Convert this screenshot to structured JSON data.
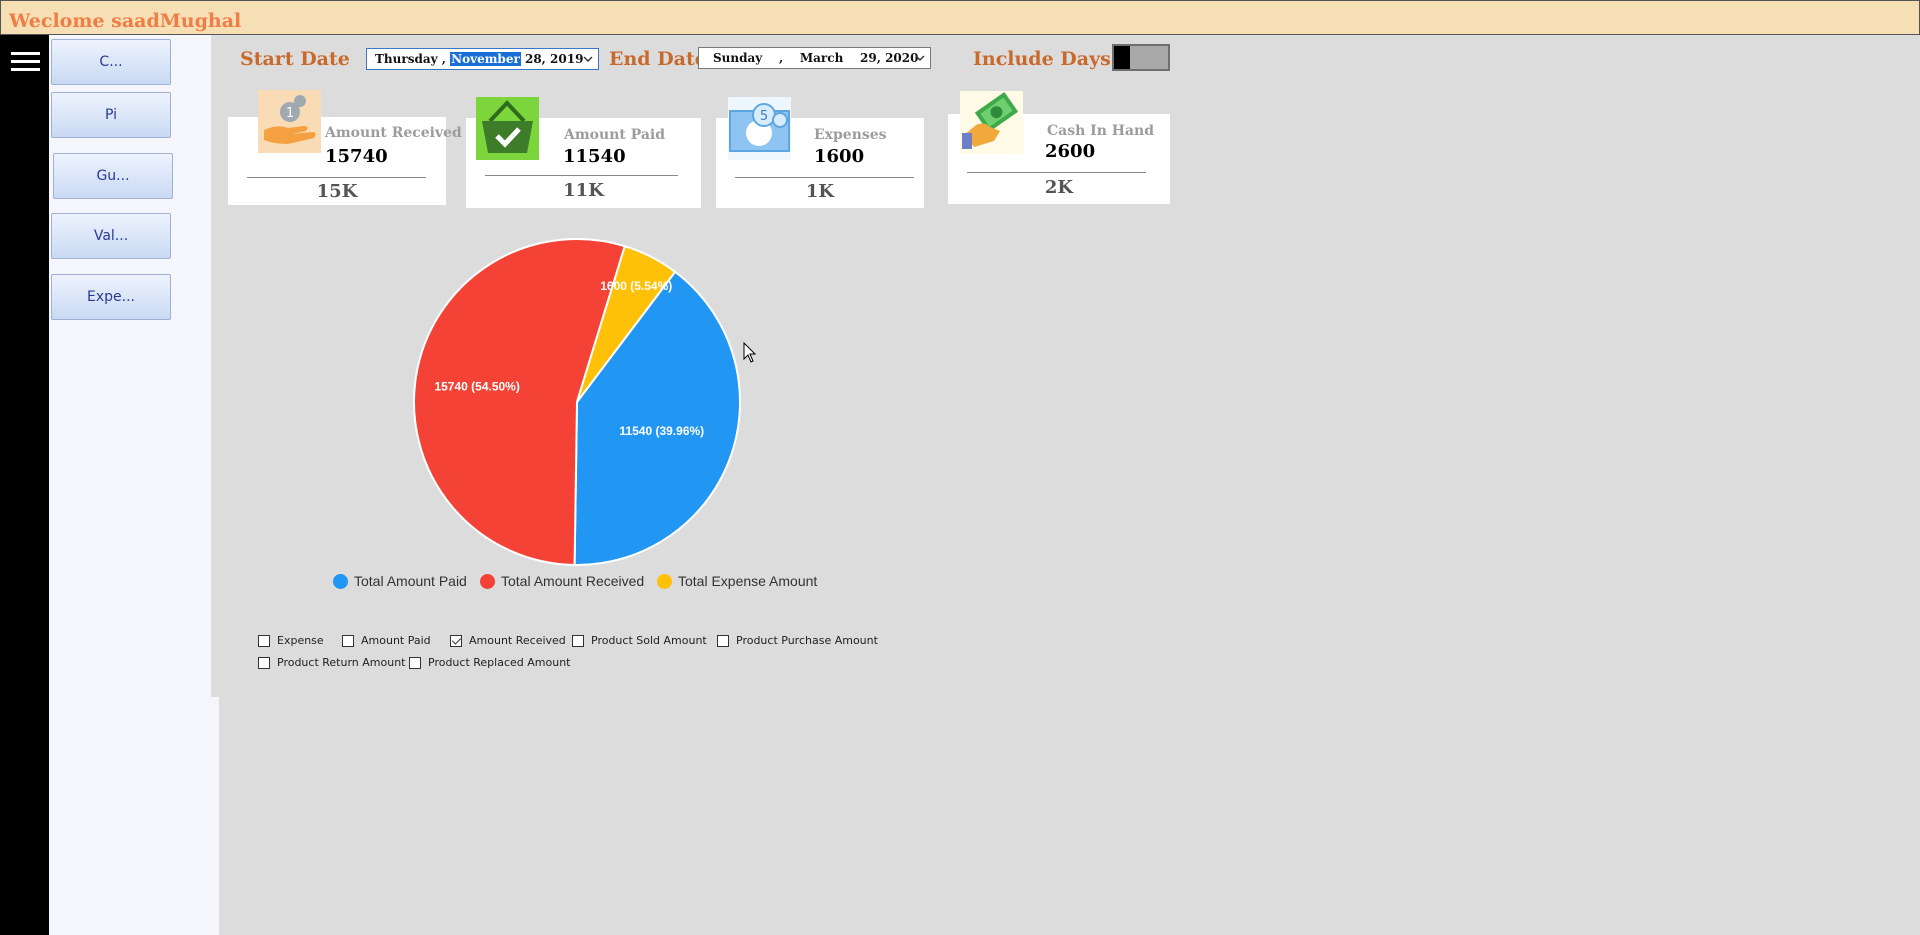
{
  "window": {
    "title": "Weclome saadMughal"
  },
  "sidebar": {
    "items": [
      {
        "label": "C..."
      },
      {
        "label": "Pi"
      },
      {
        "label": "Gu..."
      },
      {
        "label": "Val..."
      },
      {
        "label": "Expe..."
      }
    ]
  },
  "filters": {
    "start_label": "Start Date",
    "start": {
      "weekday": "Thursday",
      "month": "November",
      "day": "28",
      "year": "2019"
    },
    "end_label": "End Date",
    "end": {
      "weekday": "Sunday",
      "month": "March",
      "day": "29",
      "year": "2020"
    },
    "include_days_label": "Include Days",
    "include_days_on": false
  },
  "cards": [
    {
      "name": "Amount Received",
      "value": "15740",
      "summary": "15K",
      "icon": "hand-coins-icon"
    },
    {
      "name": "Amount Paid",
      "value": "11540",
      "summary": "11K",
      "icon": "basket-check-icon"
    },
    {
      "name": "Expenses",
      "value": "1600",
      "summary": "1K",
      "icon": "banknote-coins-icon"
    },
    {
      "name": "Cash In Hand",
      "value": "2600",
      "summary": "2K",
      "icon": "hand-cash-icon"
    }
  ],
  "chart_data": {
    "type": "pie",
    "series": [
      {
        "name": "Total Amount Paid",
        "value": 11540,
        "label": "11540 (39.96%)",
        "color": "#2196f3"
      },
      {
        "name": "Total Amount Received",
        "value": 15740,
        "label": "15740 (54.50%)",
        "color": "#f44336"
      },
      {
        "name": "Total Expense Amount",
        "value": 1600,
        "label": "1600 (5.54%)",
        "color": "#ffc107"
      }
    ],
    "legend_position": "bottom"
  },
  "checkboxes": [
    {
      "label": "Expense",
      "checked": false
    },
    {
      "label": "Amount Paid",
      "checked": false
    },
    {
      "label": "Amount Received",
      "checked": true
    },
    {
      "label": "Product Sold Amount",
      "checked": false
    },
    {
      "label": "Product Purchase Amount",
      "checked": false
    },
    {
      "label": "Product Return Amount",
      "checked": false
    },
    {
      "label": "Product Replaced Amount",
      "checked": false
    }
  ]
}
